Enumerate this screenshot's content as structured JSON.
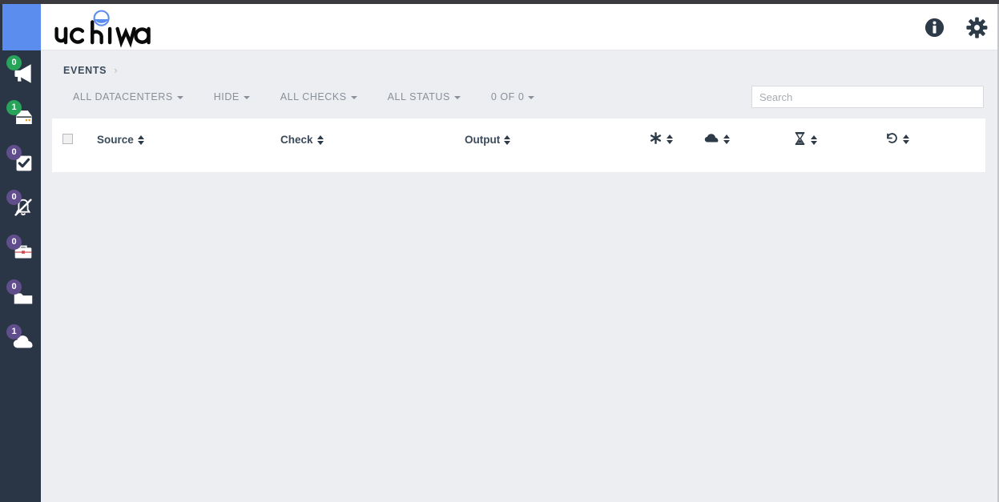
{
  "brand": {
    "name": "uchiwa",
    "logo_icon": "uchiwa-umbrella-logo"
  },
  "masthead": {
    "actions": [
      {
        "label": "Info",
        "icon": "info-circle-icon"
      },
      {
        "label": "Settings",
        "icon": "gear-icon"
      }
    ]
  },
  "sidebar": {
    "items": [
      {
        "label": "Events",
        "icon": "megaphone-icon",
        "badge": "0",
        "badge_color": "#27a35a"
      },
      {
        "label": "Clients",
        "icon": "server-icon",
        "badge": "1",
        "badge_color": "#27a35a"
      },
      {
        "label": "Checks",
        "icon": "check-square-icon",
        "badge": "0",
        "badge_color": "#604e8c"
      },
      {
        "label": "Silenced",
        "icon": "bell-slash-icon",
        "badge": "0",
        "badge_color": "#604e8c"
      },
      {
        "label": "Aggregates",
        "icon": "briefcase-icon",
        "badge": "0",
        "badge_color": "#604e8c"
      },
      {
        "label": "Stashes",
        "icon": "folder-icon",
        "badge": "0",
        "badge_color": "#604e8c"
      },
      {
        "label": "Datacenters",
        "icon": "cloud-icon",
        "badge": "1",
        "badge_color": "#604e8c"
      }
    ]
  },
  "breadcrumb": {
    "current": "EVENTS",
    "separator": "›"
  },
  "filters": [
    {
      "label": "ALL DATACENTERS",
      "name": "datacenters-filter"
    },
    {
      "label": "HIDE",
      "name": "hide-filter"
    },
    {
      "label": "ALL CHECKS",
      "name": "checks-filter"
    },
    {
      "label": "ALL STATUS",
      "name": "status-filter"
    },
    {
      "label": "0 OF 0",
      "name": "pagination-filter"
    }
  ],
  "search": {
    "placeholder": "Search",
    "value": ""
  },
  "table": {
    "select_all_checked": false,
    "columns": [
      {
        "label": "Source",
        "icon": null,
        "sortable": true
      },
      {
        "label": "Check",
        "icon": null,
        "sortable": true
      },
      {
        "label": "Output",
        "icon": null,
        "sortable": true
      },
      {
        "label": "",
        "icon": "asterisk-icon",
        "sortable": true
      },
      {
        "label": "",
        "icon": "cloud-icon",
        "sortable": true
      },
      {
        "label": "",
        "icon": "hourglass-icon",
        "sortable": true
      },
      {
        "label": "",
        "icon": "history-icon",
        "sortable": true
      }
    ],
    "rows": []
  },
  "colors": {
    "sidebar_bg": "#2a3645",
    "sidebar_head": "#5b8def",
    "content_bg": "#eceef1",
    "card_bg": "#ffffff",
    "badge_green": "#27a35a",
    "badge_purple": "#604e8c",
    "text_dark": "#3b4a5a",
    "text_muted": "#8a9099"
  }
}
